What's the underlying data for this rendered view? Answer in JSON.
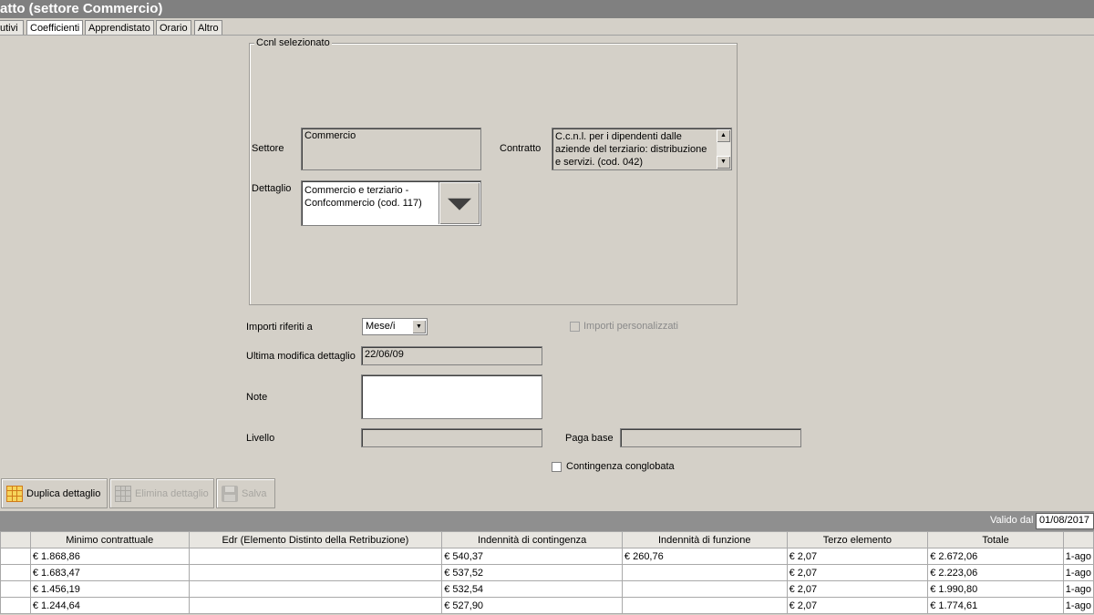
{
  "window": {
    "title": "atto (settore Commercio)"
  },
  "tabs": [
    "utivi",
    "Coefficienti",
    "Apprendistato",
    "Orario",
    "Altro"
  ],
  "ccnl_group": {
    "legend": "Ccnl selezionato",
    "settore_label": "Settore",
    "settore_value": "Commercio",
    "contratto_label": "Contratto",
    "contratto_value": "C.c.n.l. per i dipendenti dalle aziende del terziario: distribuzione e servizi. (cod. 042)",
    "dettaglio_label": "Dettaglio",
    "dettaglio_value": "Commercio e terziario - Confcommercio (cod. 117)"
  },
  "form": {
    "importi_label": "Importi riferiti a",
    "importi_value": "Mese/i",
    "importi_personalizzati_label": "Importi personalizzati",
    "ultima_modifica_label": "Ultima modifica dettaglio",
    "ultima_modifica_value": "22/06/09",
    "note_label": "Note",
    "note_value": "",
    "livello_label": "Livello",
    "livello_value": "",
    "paga_base_label": "Paga base",
    "paga_base_value": "",
    "contingenza_label": "Contingenza conglobata"
  },
  "toolbar": {
    "duplica_label": "Duplica dettaglio",
    "elimina_label": "Elimina dettaglio",
    "salva_label": "Salva"
  },
  "status": {
    "valido_label": "Valido dal",
    "valido_value": "01/08/2017"
  },
  "table": {
    "headers": [
      "",
      "Minimo contrattuale",
      "Edr (Elemento Distinto della Retribuzione)",
      "Indennità di contingenza",
      "Indennità di funzione",
      "Terzo elemento",
      "Totale",
      ""
    ],
    "rows": [
      [
        "",
        "€ 1.868,86",
        "",
        "€ 540,37",
        "€ 260,76",
        "€ 2,07",
        "€ 2.672,06",
        "1-ago"
      ],
      [
        "",
        "€ 1.683,47",
        "",
        "€ 537,52",
        "",
        "€ 2,07",
        "€ 2.223,06",
        "1-ago"
      ],
      [
        "",
        "€ 1.456,19",
        "",
        "€ 532,54",
        "",
        "€ 2,07",
        "€ 1.990,80",
        "1-ago"
      ],
      [
        "",
        "€ 1.244,64",
        "",
        "€ 527,90",
        "",
        "€ 2,07",
        "€ 1.774,61",
        "1-ago"
      ]
    ]
  }
}
